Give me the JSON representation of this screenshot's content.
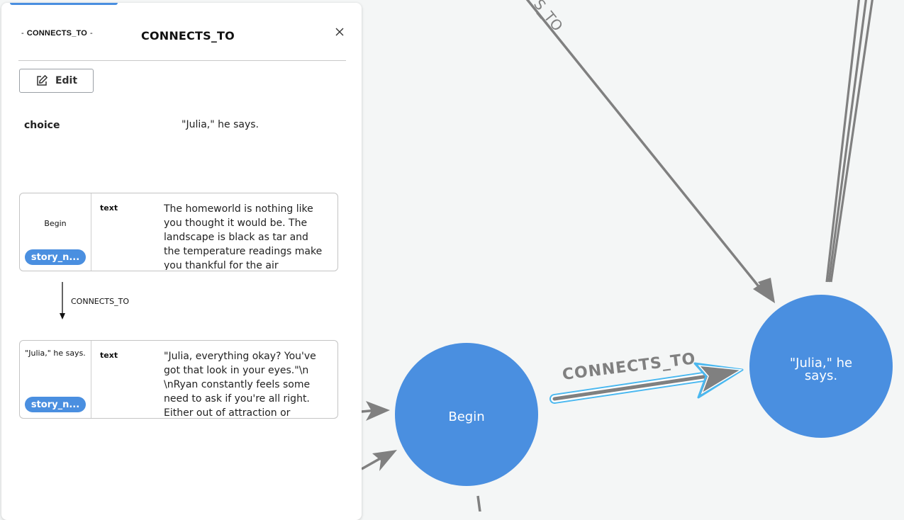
{
  "colors": {
    "accent": "#4a8fe0",
    "node_fill": "#4a8fe0",
    "edge": "#808080",
    "selected_edge_outline": "#4ab8f0",
    "canvas_bg": "#f4f6f6"
  },
  "graph": {
    "nodes": [
      {
        "id": "begin",
        "label": "Begin"
      },
      {
        "id": "julia",
        "label_line1": "\"Julia,\" he",
        "label_line2": "says."
      }
    ],
    "edge_label_selected": "CONNECTS_TO",
    "edge_label_partial": "S_TO"
  },
  "panel": {
    "relationship_chip": "CONNECTS_TO",
    "title": "CONNECTS_TO",
    "close_icon": "close-icon",
    "edit_label": "Edit",
    "edit_icon": "edit-pencil-icon",
    "properties": [
      {
        "key": "choice",
        "value": "\"Julia,\" he says."
      }
    ],
    "source_card": {
      "name": "Begin",
      "label_pill": "story_n...",
      "prop_key": "text",
      "prop_value": "The homeworld is nothing like you thought it would be. The landscape is black as tar and the temperature readings make you thankful for the air"
    },
    "relationship_label": "CONNECTS_TO",
    "target_card": {
      "name": "\"Julia,\" he says.",
      "label_pill": "story_n...",
      "prop_key": "text",
      "prop_value": "\"Julia, everything okay? You've got that look in your eyes.\"\\n \\nRyan constantly feels some need to ask if you're all right. Either out of attraction or"
    }
  }
}
